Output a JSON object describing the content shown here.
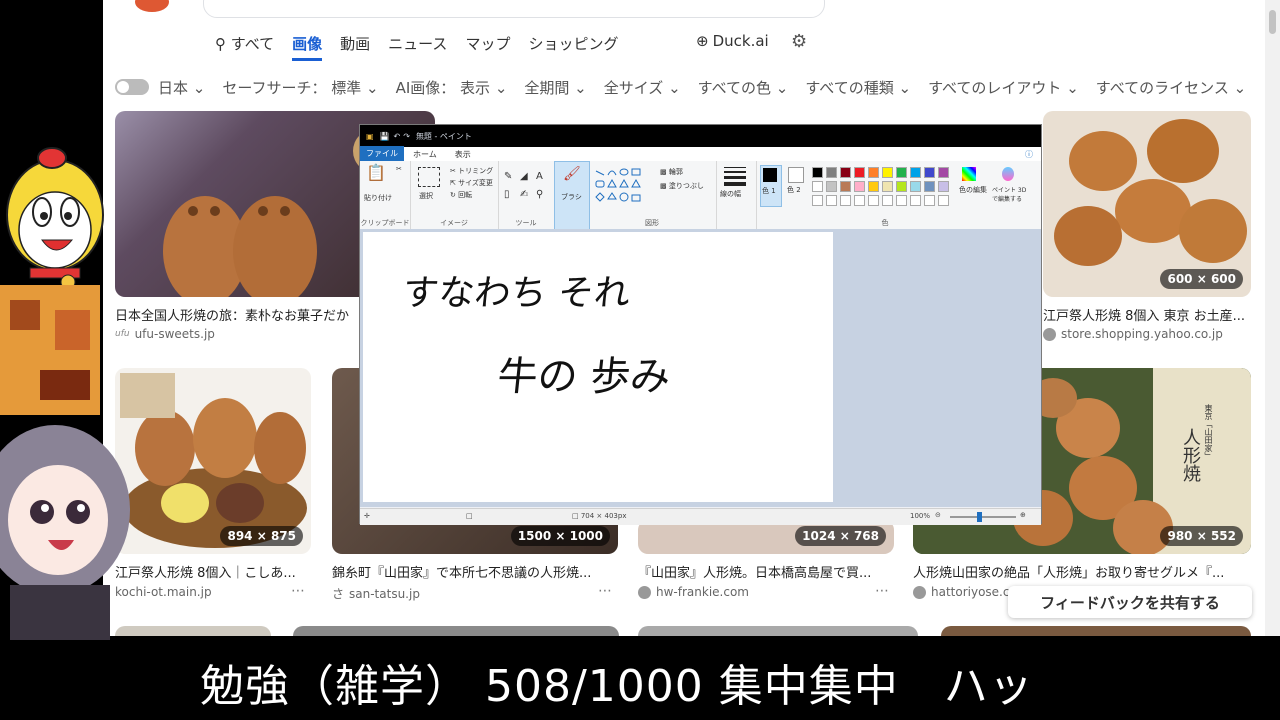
{
  "browser": {
    "tabs": [
      "すべて",
      "画像",
      "動画",
      "ニュース",
      "マップ",
      "ショッピング"
    ],
    "tab_search_label": "すべて",
    "duck_ai": "Duck.ai",
    "filters": [
      "日本",
      "セーフサーチ： 標準",
      "AI画像： 表示",
      "全期間",
      "全サイズ",
      "すべての色",
      "すべての種類",
      "すべてのレイアウト",
      "すべてのライセンス"
    ],
    "results": [
      {
        "caption": "日本全国人形焼の旅：素朴なお菓子だか",
        "source": "ufu-sweets.jp"
      },
      {
        "caption": "江戸祭人形焼 8個入 東京 お土産...",
        "source": "store.shopping.yahoo.co.jp",
        "dim": "600 × 600"
      },
      {
        "caption": "江戸祭人形焼 8個入｜こしあ...",
        "source": "kochi-ot.main.jp",
        "dim": "894 × 875"
      },
      {
        "caption": "錦糸町『山田家』で本所七不思議の人形焼...",
        "source": "san-tatsu.jp",
        "dim": "1500 × 1000"
      },
      {
        "caption": "『山田家』人形焼。日本橋高島屋で買...",
        "source": "hw-frankie.com",
        "dim": "1024 × 768"
      },
      {
        "caption": "人形焼山田家の絶品「人形焼」お取り寄せグルメ『...",
        "source": "hattoriyose.c",
        "dim": "980 × 552"
      }
    ],
    "feedback": "フィードバックを共有する",
    "product_label": "人形焼",
    "product_brand": "東京「山田家」"
  },
  "paint": {
    "title": "無題 - ペイント",
    "menu": [
      "ファイル",
      "ホーム",
      "表示"
    ],
    "groups": {
      "clipboard": "クリップボード",
      "image": "イメージ",
      "tools": "ツール",
      "shapes": "図形",
      "colors": "色"
    },
    "labels": {
      "paste": "貼り付け",
      "select": "選択",
      "trim": "トリミング",
      "resize": "サイズ変更",
      "rotate": "回転",
      "brush": "ブラシ",
      "outline": "輪郭",
      "fill": "塗りつぶし",
      "line_width": "線の幅",
      "color1": "色 1",
      "color2": "色 2",
      "edit_colors": "色の編集",
      "paint3d": "ペイント 3D で編集する"
    },
    "palette": [
      "#000000",
      "#7f7f7f",
      "#880015",
      "#ed1c24",
      "#ff7f27",
      "#fff200",
      "#22b14c",
      "#00a2e8",
      "#3f48cc",
      "#a349a4",
      "#ffffff",
      "#c3c3c3",
      "#b97a57",
      "#ffaec9",
      "#ffc90e",
      "#efe4b0",
      "#b5e61d",
      "#99d9ea",
      "#7092be",
      "#c8bfe7"
    ],
    "status_size": "704 × 403px",
    "zoom": "100%",
    "handwriting": [
      "すなわち それ",
      "牛の 歩み"
    ]
  },
  "overlay": {
    "caption": "勉強（雑学） 508/1000 集中集中　ハッ"
  }
}
